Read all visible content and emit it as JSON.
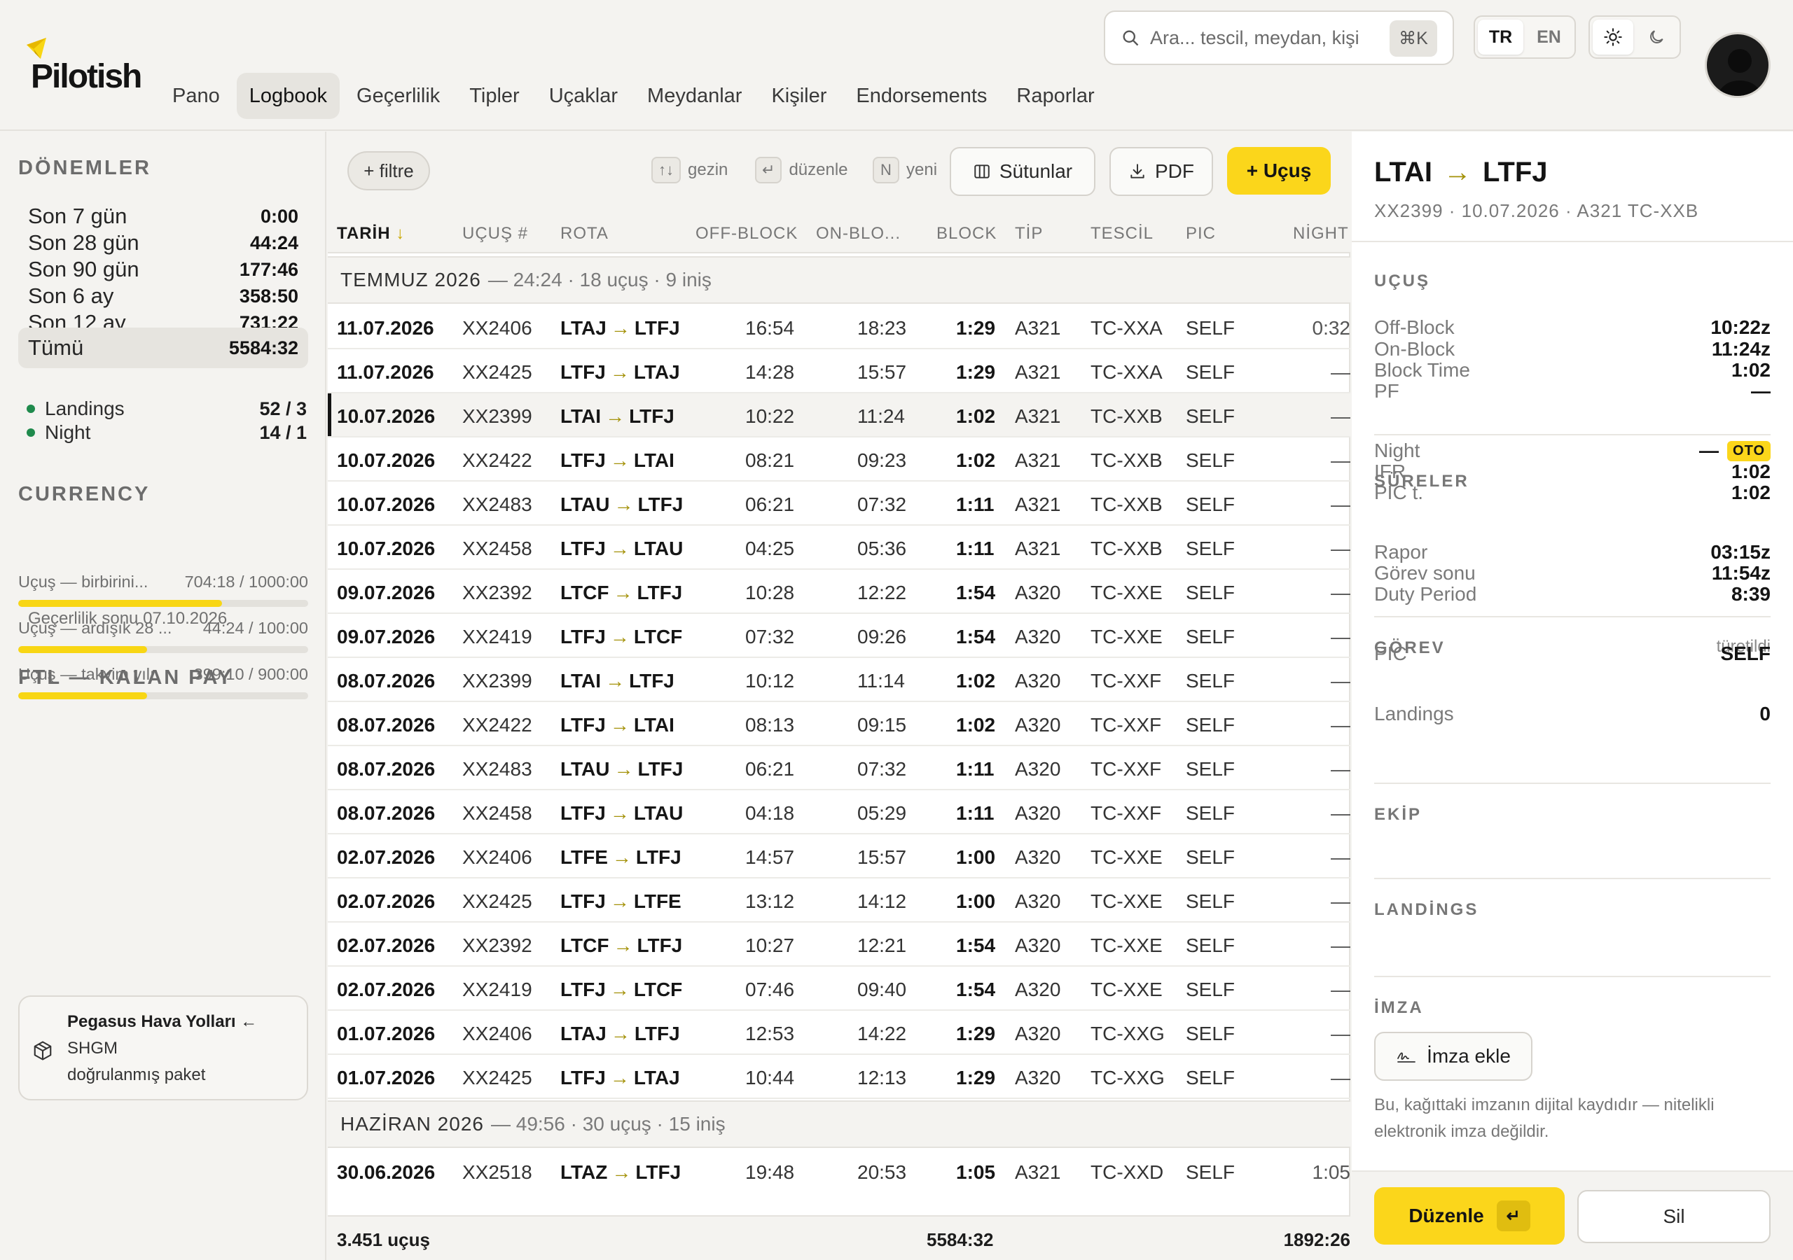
{
  "app": {
    "name": "Pilotish"
  },
  "nav": [
    {
      "label": "Pano",
      "active": false
    },
    {
      "label": "Logbook",
      "active": true
    },
    {
      "label": "Geçerlilik",
      "active": false
    },
    {
      "label": "Tipler",
      "active": false
    },
    {
      "label": "Uçaklar",
      "active": false
    },
    {
      "label": "Meydanlar",
      "active": false
    },
    {
      "label": "Kişiler",
      "active": false
    },
    {
      "label": "Endorsements",
      "active": false
    },
    {
      "label": "Raporlar",
      "active": false
    }
  ],
  "search": {
    "placeholder": "Ara... tescil, meydan, kişi",
    "shortcut": "⌘K"
  },
  "lang": {
    "tr": "TR",
    "en": "EN",
    "active": "TR"
  },
  "theme": {
    "active": "light"
  },
  "sidebar": {
    "periods_title": "DÖNEMLER",
    "periods": [
      {
        "label": "Son 7 gün",
        "value": "0:00"
      },
      {
        "label": "Son 28 gün",
        "value": "44:24"
      },
      {
        "label": "Son 90 gün",
        "value": "177:46"
      },
      {
        "label": "Son 6 ay",
        "value": "358:50"
      },
      {
        "label": "Son 12 ay",
        "value": "731:22"
      },
      {
        "label": "Tümü",
        "value": "5584:32",
        "active": true
      }
    ],
    "currency_title": "CURRENCY",
    "currency": [
      {
        "label": "Landings",
        "value": "52 / 3"
      },
      {
        "label": "Night",
        "value": "14 / 1"
      }
    ],
    "validity": "Geçerlilik sonu 07.10.2026",
    "ftl_title": "FTL — KALAN PAY",
    "ftl": [
      {
        "label": "Uçuş — birbirini...",
        "value": "704:18 / 1000:00",
        "fraction": 0.704
      },
      {
        "label": "Uçuş — ardışık 28 ...",
        "value": "44:24 / 100:00",
        "fraction": 0.444
      },
      {
        "label": "Uçuş — takvim yılı",
        "value": "399:10 / 900:00",
        "fraction": 0.4435
      }
    ],
    "package": {
      "title": "Pegasus Hava Yolları ←",
      "line1": "SHGM",
      "line2": "doğrulanmış paket"
    }
  },
  "toolbar": {
    "filter": "+ filtre",
    "hints": [
      {
        "key": "↑↓",
        "label": "gezin"
      },
      {
        "key": "↵",
        "label": "düzenle"
      },
      {
        "key": "N",
        "label": "yeni"
      }
    ],
    "columns_btn": "Sütunlar",
    "pdf_btn": "PDF",
    "add_btn": "+ Uçuş"
  },
  "table": {
    "headers": {
      "date": "TARİH",
      "flight": "UÇUŞ #",
      "route": "ROTA",
      "off": "OFF-BLOCK",
      "on": "ON-BLO...",
      "block": "BLOCK",
      "type": "TİP",
      "reg": "TESCİL",
      "pic": "PIC",
      "night": "NİGHT"
    },
    "sort_indicator": "↓",
    "groups": [
      {
        "month": "TEMMUZ 2026",
        "summary": "— 24:24 · 18 uçuş · 9 iniş"
      },
      {
        "month": "HAZİRAN 2026",
        "summary": "— 49:56 · 30 uçuş · 15 iniş"
      }
    ],
    "rows": [
      {
        "date": "11.07.2026",
        "flight": "XX2406",
        "from": "LTAJ",
        "to": "LTFJ",
        "off": "16:54",
        "on": "18:23",
        "block": "1:29",
        "type": "A321",
        "reg": "TC-XXA",
        "pic": "SELF",
        "night": "0:32"
      },
      {
        "date": "11.07.2026",
        "flight": "XX2425",
        "from": "LTFJ",
        "to": "LTAJ",
        "off": "14:28",
        "on": "15:57",
        "block": "1:29",
        "type": "A321",
        "reg": "TC-XXA",
        "pic": "SELF",
        "night": "—"
      },
      {
        "date": "10.07.2026",
        "flight": "XX2399",
        "from": "LTAI",
        "to": "LTFJ",
        "off": "10:22",
        "on": "11:24",
        "block": "1:02",
        "type": "A321",
        "reg": "TC-XXB",
        "pic": "SELF",
        "night": "—",
        "selected": true
      },
      {
        "date": "10.07.2026",
        "flight": "XX2422",
        "from": "LTFJ",
        "to": "LTAI",
        "off": "08:21",
        "on": "09:23",
        "block": "1:02",
        "type": "A321",
        "reg": "TC-XXB",
        "pic": "SELF",
        "night": "—"
      },
      {
        "date": "10.07.2026",
        "flight": "XX2483",
        "from": "LTAU",
        "to": "LTFJ",
        "off": "06:21",
        "on": "07:32",
        "block": "1:11",
        "type": "A321",
        "reg": "TC-XXB",
        "pic": "SELF",
        "night": "—"
      },
      {
        "date": "10.07.2026",
        "flight": "XX2458",
        "from": "LTFJ",
        "to": "LTAU",
        "off": "04:25",
        "on": "05:36",
        "block": "1:11",
        "type": "A321",
        "reg": "TC-XXB",
        "pic": "SELF",
        "night": "—"
      },
      {
        "date": "09.07.2026",
        "flight": "XX2392",
        "from": "LTCF",
        "to": "LTFJ",
        "off": "10:28",
        "on": "12:22",
        "block": "1:54",
        "type": "A320",
        "reg": "TC-XXE",
        "pic": "SELF",
        "night": "—"
      },
      {
        "date": "09.07.2026",
        "flight": "XX2419",
        "from": "LTFJ",
        "to": "LTCF",
        "off": "07:32",
        "on": "09:26",
        "block": "1:54",
        "type": "A320",
        "reg": "TC-XXE",
        "pic": "SELF",
        "night": "—"
      },
      {
        "date": "08.07.2026",
        "flight": "XX2399",
        "from": "LTAI",
        "to": "LTFJ",
        "off": "10:12",
        "on": "11:14",
        "block": "1:02",
        "type": "A320",
        "reg": "TC-XXF",
        "pic": "SELF",
        "night": "—"
      },
      {
        "date": "08.07.2026",
        "flight": "XX2422",
        "from": "LTFJ",
        "to": "LTAI",
        "off": "08:13",
        "on": "09:15",
        "block": "1:02",
        "type": "A320",
        "reg": "TC-XXF",
        "pic": "SELF",
        "night": "—"
      },
      {
        "date": "08.07.2026",
        "flight": "XX2483",
        "from": "LTAU",
        "to": "LTFJ",
        "off": "06:21",
        "on": "07:32",
        "block": "1:11",
        "type": "A320",
        "reg": "TC-XXF",
        "pic": "SELF",
        "night": "—"
      },
      {
        "date": "08.07.2026",
        "flight": "XX2458",
        "from": "LTFJ",
        "to": "LTAU",
        "off": "04:18",
        "on": "05:29",
        "block": "1:11",
        "type": "A320",
        "reg": "TC-XXF",
        "pic": "SELF",
        "night": "—"
      },
      {
        "date": "02.07.2026",
        "flight": "XX2406",
        "from": "LTFE",
        "to": "LTFJ",
        "off": "14:57",
        "on": "15:57",
        "block": "1:00",
        "type": "A320",
        "reg": "TC-XXE",
        "pic": "SELF",
        "night": "—"
      },
      {
        "date": "02.07.2026",
        "flight": "XX2425",
        "from": "LTFJ",
        "to": "LTFE",
        "off": "13:12",
        "on": "14:12",
        "block": "1:00",
        "type": "A320",
        "reg": "TC-XXE",
        "pic": "SELF",
        "night": "—"
      },
      {
        "date": "02.07.2026",
        "flight": "XX2392",
        "from": "LTCF",
        "to": "LTFJ",
        "off": "10:27",
        "on": "12:21",
        "block": "1:54",
        "type": "A320",
        "reg": "TC-XXE",
        "pic": "SELF",
        "night": "—"
      },
      {
        "date": "02.07.2026",
        "flight": "XX2419",
        "from": "LTFJ",
        "to": "LTCF",
        "off": "07:46",
        "on": "09:40",
        "block": "1:54",
        "type": "A320",
        "reg": "TC-XXE",
        "pic": "SELF",
        "night": "—"
      },
      {
        "date": "01.07.2026",
        "flight": "XX2406",
        "from": "LTAJ",
        "to": "LTFJ",
        "off": "12:53",
        "on": "14:22",
        "block": "1:29",
        "type": "A320",
        "reg": "TC-XXG",
        "pic": "SELF",
        "night": "—"
      },
      {
        "date": "01.07.2026",
        "flight": "XX2425",
        "from": "LTFJ",
        "to": "LTAJ",
        "off": "10:44",
        "on": "12:13",
        "block": "1:29",
        "type": "A320",
        "reg": "TC-XXG",
        "pic": "SELF",
        "night": "—"
      },
      {
        "date": "30.06.2026",
        "flight": "XX2518",
        "from": "LTAZ",
        "to": "LTFJ",
        "off": "19:48",
        "on": "20:53",
        "block": "1:05",
        "type": "A321",
        "reg": "TC-XXD",
        "pic": "SELF",
        "night": "1:05"
      }
    ],
    "footer": {
      "count": "3.451 uçuş",
      "block_total": "5584:32",
      "night_total": "1892:26"
    }
  },
  "detail": {
    "from": "LTAI",
    "to": "LTFJ",
    "subtitle": "XX2399 · 10.07.2026 · A321 TC-XXB",
    "sections": {
      "flight": "UÇUŞ",
      "times": "SÜRELER",
      "duty": "GÖREV",
      "duty_note": "türetildi",
      "crew": "EKİP",
      "landings": "LANDİNGS",
      "signature": "İMZA"
    },
    "flight": [
      {
        "label": "Off-Block",
        "value": "10:22z"
      },
      {
        "label": "On-Block",
        "value": "11:24z"
      },
      {
        "label": "Block Time",
        "value": "1:02"
      },
      {
        "label": "PF",
        "value": "—"
      }
    ],
    "times": [
      {
        "label": "Night",
        "value": "—",
        "badge": "OTO"
      },
      {
        "label": "IFR",
        "value": "1:02"
      },
      {
        "label": "PIC t.",
        "value": "1:02"
      }
    ],
    "duty": [
      {
        "label": "Rapor",
        "value": "03:15z"
      },
      {
        "label": "Görev sonu",
        "value": "11:54z"
      },
      {
        "label": "Duty Period",
        "value": "8:39"
      }
    ],
    "crew": [
      {
        "label": "PIC",
        "value": "SELF"
      }
    ],
    "landings": [
      {
        "label": "Landings",
        "value": "0"
      }
    ],
    "signature_btn": "İmza ekle",
    "signature_note": "Bu, kağıttaki imzanın dijital kaydıdır — nitelikli elektronik imza değildir.",
    "edit_btn": "Düzenle",
    "edit_key": "↵",
    "delete_btn": "Sil"
  },
  "colors": {
    "accent": "#fbd61b",
    "route_arrow": "#a4920a",
    "status_green": "#1f8a4c"
  },
  "icons": [
    "logo-mark-icon",
    "search-icon",
    "sun-icon",
    "moon-icon",
    "user-icon",
    "columns-icon",
    "download-icon",
    "package-icon",
    "signature-icon",
    "sort-arrow-icon",
    "route-arrow-icon"
  ]
}
